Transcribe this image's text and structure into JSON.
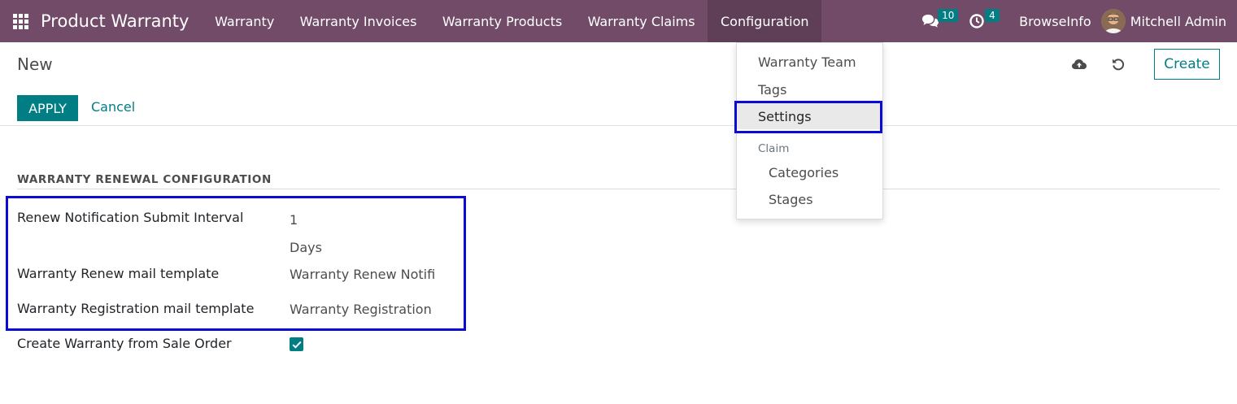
{
  "navbar": {
    "brand": "Product Warranty",
    "menu": [
      "Warranty",
      "Warranty Invoices",
      "Warranty Products",
      "Warranty Claims",
      "Configuration"
    ],
    "messages_count": "10",
    "activities_count": "4",
    "company": "BrowseInfo",
    "user_name": "Mitchell Admin"
  },
  "control_panel": {
    "title": "New",
    "create_label": "Create",
    "apply_label": "APPLY",
    "cancel_label": "Cancel"
  },
  "section": {
    "title": "WARRANTY RENEWAL CONFIGURATION",
    "fields": [
      {
        "label": "Renew Notification Submit Interval",
        "value": "1",
        "unit": "Days"
      },
      {
        "label": "Warranty Renew mail template",
        "value": "Warranty Renew Notifi"
      },
      {
        "label": "Warranty Registration mail template",
        "value": "Warranty Registration"
      },
      {
        "label": "Create Warranty from Sale Order",
        "checked": true
      }
    ]
  },
  "config_menu": {
    "items": [
      "Warranty Team",
      "Tags",
      "Settings"
    ],
    "claim_header": "Claim",
    "claim_items": [
      "Categories",
      "Stages"
    ]
  },
  "colors": {
    "navbar": "#714b67",
    "accent": "#017e84",
    "highlight": "#0b0bd8"
  }
}
